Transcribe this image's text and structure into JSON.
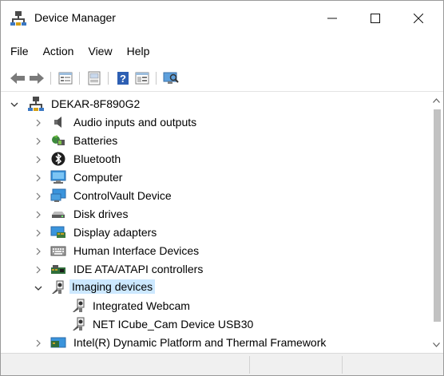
{
  "window": {
    "title": "Device Manager"
  },
  "caption_buttons": {
    "minimize": "—",
    "maximize": "☐",
    "close": "✕"
  },
  "menu": [
    "File",
    "Action",
    "View",
    "Help"
  ],
  "toolbar": [
    "back-icon",
    "forward-icon",
    "properties-icon",
    "update-driver-icon",
    "help-icon",
    "view-icon",
    "scan-hardware-icon"
  ],
  "tree": {
    "root": "DEKAR-8F890G2",
    "categories": [
      {
        "label": "Audio inputs and outputs",
        "icon": "speaker-icon",
        "expanded": false
      },
      {
        "label": "Batteries",
        "icon": "battery-icon",
        "expanded": false
      },
      {
        "label": "Bluetooth",
        "icon": "bluetooth-icon",
        "expanded": false
      },
      {
        "label": "Computer",
        "icon": "computer-icon",
        "expanded": false
      },
      {
        "label": "ControlVault Device",
        "icon": "controlvault-icon",
        "expanded": false
      },
      {
        "label": "Disk drives",
        "icon": "disk-drive-icon",
        "expanded": false
      },
      {
        "label": "Display adapters",
        "icon": "display-adapter-icon",
        "expanded": false
      },
      {
        "label": "Human Interface Devices",
        "icon": "hid-icon",
        "expanded": false
      },
      {
        "label": "IDE ATA/ATAPI controllers",
        "icon": "ide-controller-icon",
        "expanded": false
      },
      {
        "label": "Imaging devices",
        "icon": "camera-icon",
        "expanded": true,
        "selected": true,
        "children": [
          {
            "label": "Integrated Webcam",
            "icon": "camera-icon"
          },
          {
            "label": "NET ICube_Cam Device USB30",
            "icon": "camera-icon"
          }
        ]
      },
      {
        "label": "Intel(R) Dynamic Platform and Thermal Framework",
        "icon": "chip-icon",
        "expanded": false
      }
    ]
  },
  "scrollbar": {
    "up": "▲",
    "down": "▼"
  }
}
